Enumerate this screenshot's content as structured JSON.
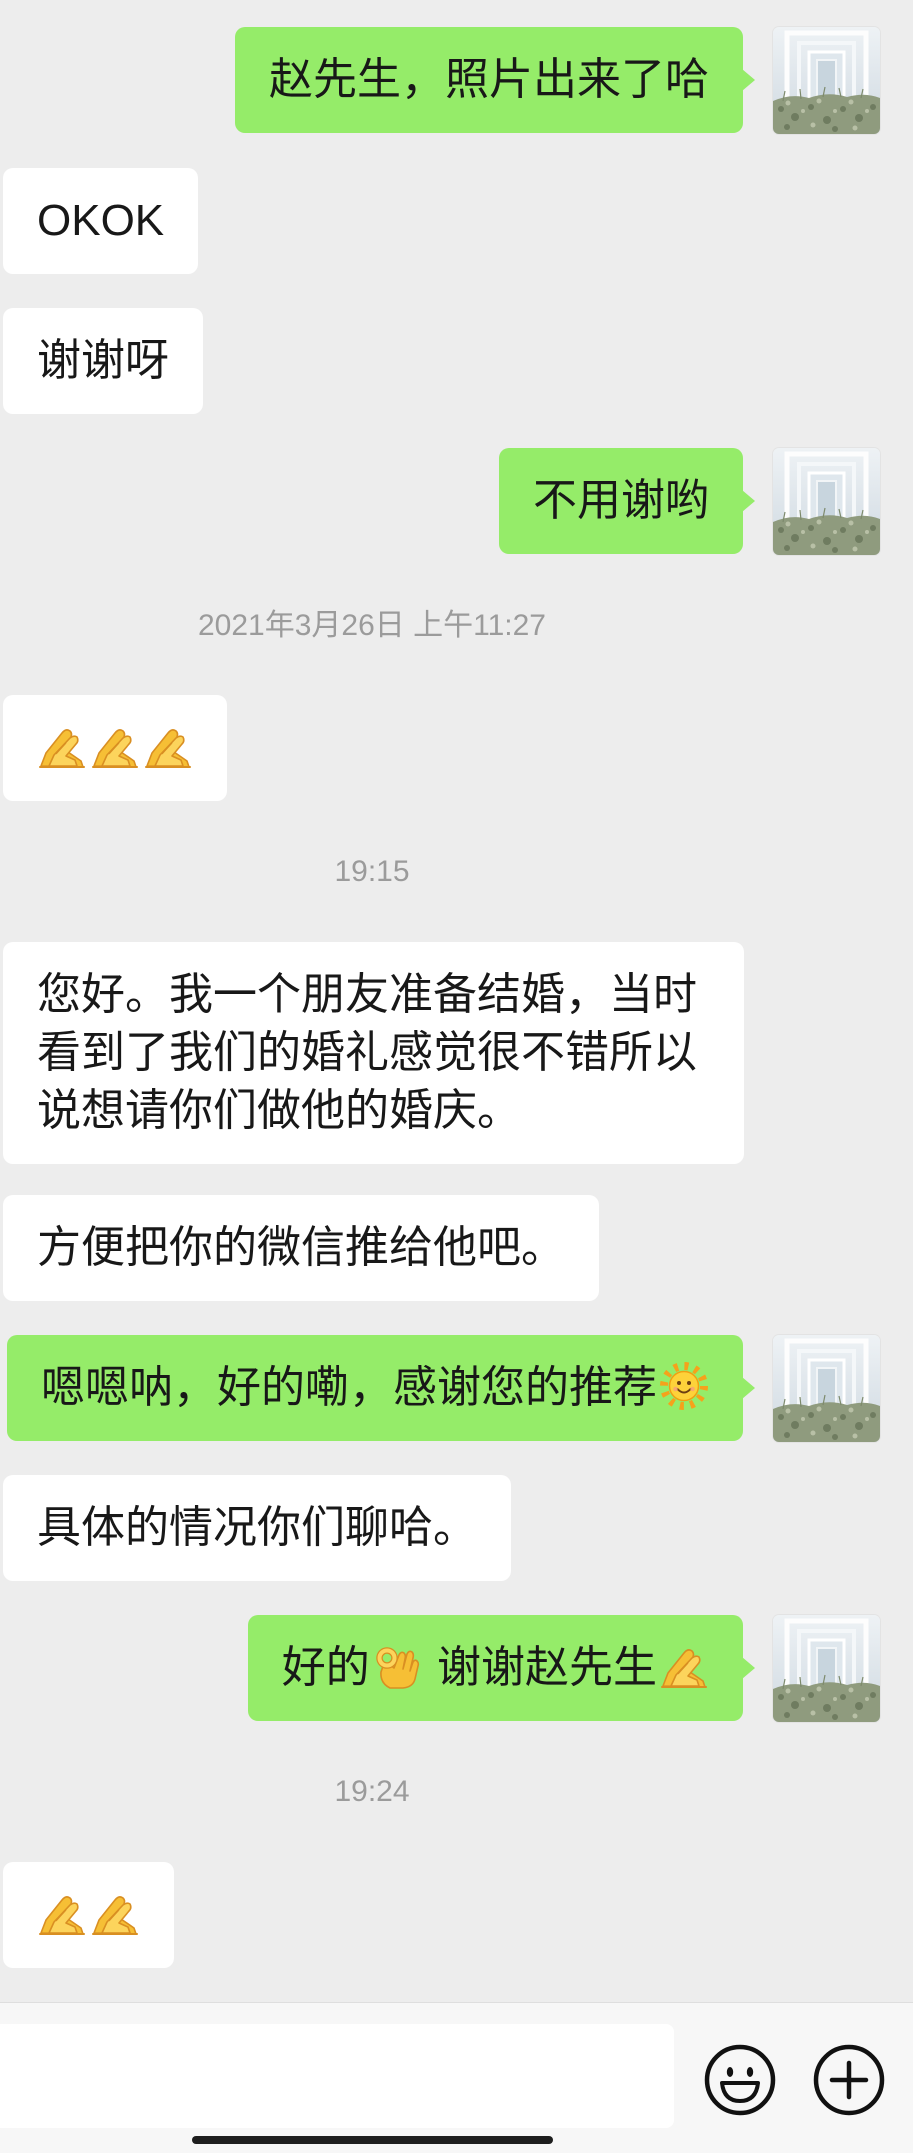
{
  "chat": {
    "items": [
      {
        "outgoing": true,
        "segments": [
          {
            "text": "赵先生，照片出来了哈"
          }
        ],
        "avatar_icon": "avatar-photo"
      },
      {
        "outgoing": false,
        "segments": [
          {
            "text": "OKOK"
          }
        ]
      },
      {
        "outgoing": false,
        "segments": [
          {
            "text": "谢谢呀"
          }
        ]
      },
      {
        "outgoing": true,
        "segments": [
          {
            "text": "不用谢哟"
          }
        ],
        "avatar_icon": "avatar-photo"
      },
      {
        "timestamp": "2021年3月26日 上午11:27"
      },
      {
        "outgoing": false,
        "segments": [
          {
            "icon": "pray-emoji"
          },
          {
            "icon": "pray-emoji"
          },
          {
            "icon": "pray-emoji"
          }
        ]
      },
      {
        "timestamp": "19:15"
      },
      {
        "outgoing": false,
        "segments": [
          {
            "text": "您好。我一个朋友准备结婚，当时看到了我们的婚礼感觉很不错所以说想请你们做他的婚庆。"
          }
        ]
      },
      {
        "outgoing": false,
        "segments": [
          {
            "text": "方便把你的微信推给他吧。"
          }
        ]
      },
      {
        "outgoing": true,
        "segments": [
          {
            "text": "嗯嗯呐，好的嘞，感谢您的推荐"
          },
          {
            "icon": "sun-emoji"
          }
        ],
        "avatar_icon": "avatar-photo"
      },
      {
        "outgoing": false,
        "segments": [
          {
            "text": "具体的情况你们聊哈。"
          }
        ]
      },
      {
        "outgoing": true,
        "segments": [
          {
            "text": "好的"
          },
          {
            "icon": "ok-hand-emoji"
          },
          {
            "text": " 谢谢赵先生"
          },
          {
            "icon": "pray-emoji"
          }
        ],
        "avatar_icon": "avatar-photo"
      },
      {
        "timestamp": "19:24"
      },
      {
        "outgoing": false,
        "segments": [
          {
            "icon": "pray-emoji"
          },
          {
            "icon": "pray-emoji"
          }
        ]
      }
    ]
  },
  "input_bar": {
    "input_value": "",
    "emoji_button_icon": "smiley-icon",
    "more_button_icon": "plus-circle-icon"
  },
  "colors": {
    "background": "#ededed",
    "sent_bubble": "#95ec69",
    "received_bubble": "#ffffff",
    "timestamp_text": "#9b9b9b",
    "input_bar": "#f7f7f7"
  }
}
